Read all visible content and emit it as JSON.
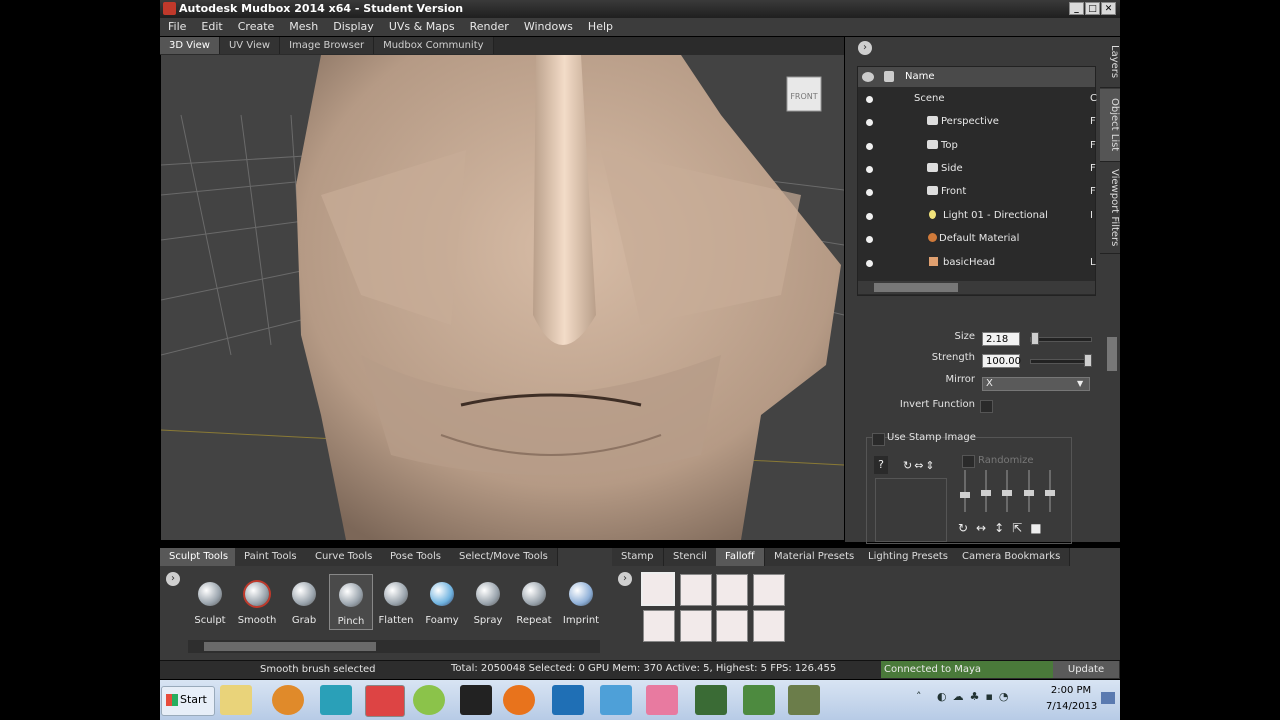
{
  "window": {
    "title": "Autodesk Mudbox 2014 x64 - Student Version",
    "min_glyph": "_",
    "max_glyph": "□",
    "close_glyph": "✕"
  },
  "menu": [
    "File",
    "Edit",
    "Create",
    "Mesh",
    "Display",
    "UVs & Maps",
    "Render",
    "Windows",
    "Help"
  ],
  "view_tabs": [
    "3D View",
    "UV View",
    "Image Browser",
    "Mudbox Community"
  ],
  "viewport": {
    "view_cube_label": "FRONT"
  },
  "side_tabs": [
    "Layers",
    "Object List",
    "Viewport Filters"
  ],
  "object_list": {
    "header": "Name",
    "items": [
      "Scene",
      "Perspective",
      "Top",
      "Side",
      "Front",
      "Light 01 - Directional",
      "Default Material",
      "basicHead"
    ],
    "trailing": [
      "C",
      "F",
      "F",
      "F",
      "F",
      "I",
      "",
      "L"
    ]
  },
  "properties": {
    "size_label": "Size",
    "size_value": "2.18",
    "size_fraction": 0.02,
    "strength_label": "Strength",
    "strength_value": "100.00",
    "strength_fraction": 1.0,
    "mirror_label": "Mirror",
    "mirror_value": "X",
    "invert_label": "Invert Function",
    "stamp_label": "Use Stamp Image",
    "randomize_label": "Randomize"
  },
  "tool_tabs": [
    "Sculpt Tools",
    "Paint Tools",
    "Curve Tools",
    "Pose Tools",
    "Select/Move Tools"
  ],
  "tools": [
    "Sculpt",
    "Smooth",
    "Grab",
    "Pinch",
    "Flatten",
    "Foamy",
    "Spray",
    "Repeat",
    "Imprint"
  ],
  "selected_tool": "Pinch",
  "tray_tabs": [
    "Stamp",
    "Stencil",
    "Falloff",
    "Material Presets",
    "Lighting Presets",
    "Camera Bookmarks"
  ],
  "status": {
    "message": "Smooth brush selected",
    "stats": "Total: 2050048  Selected: 0 GPU Mem: 370  Active: 5, Highest: 5  FPS: 126.455",
    "connection": "Connected to Maya",
    "update_label": "Update"
  },
  "taskbar": {
    "start_label": "Start",
    "time": "2:00 PM",
    "date": "7/14/2013"
  }
}
